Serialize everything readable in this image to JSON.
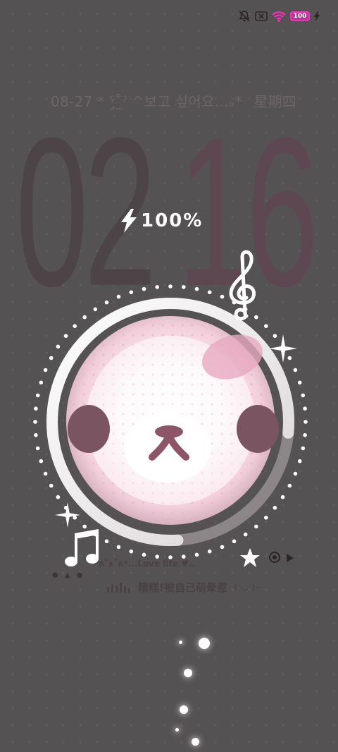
{
  "status_bar": {
    "battery_level": "100",
    "icons": [
      "mute-bell-icon",
      "sim-off-icon",
      "wifi-icon",
      "battery-icon",
      "charging-bolt-icon"
    ],
    "accent_color": "#ff2cc0"
  },
  "lockscreen": {
    "date": "08-27",
    "decor_text": "* ˁ̡˚̫ˀ ^보고 싶어요...ₒ*",
    "weekday": "星期四",
    "hours": "02",
    "minutes": "16",
    "charge_percent": "100%",
    "charge_level": 1.0
  },
  "music_widget": {
    "lyric": "ฅ˚ᴥ˚ฅ*...Love life ♥..",
    "song_title": "糟糕!被自己萌晕惹",
    "song_artist": "(´◡`)~",
    "dots": "● ▲ ●",
    "icons": [
      "treble-clef-icon",
      "eighth-notes-icon",
      "sparkle-icon",
      "star-icon",
      "target-icon",
      "play-icon",
      "bear-face-icon",
      "equalizer-icon"
    ]
  },
  "theme": {
    "background": "#555254",
    "bear_pink": "#f7dde8",
    "bear_ear": "#7a5561",
    "nose": "#8e5467"
  }
}
